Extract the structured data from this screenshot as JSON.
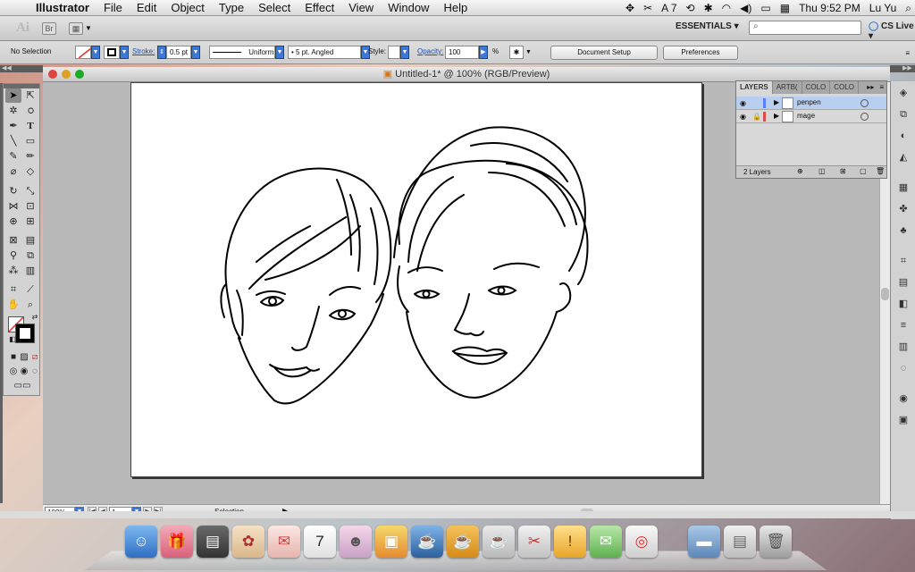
{
  "menubar": {
    "apple_icon": "apple-icon",
    "app_name": "Illustrator",
    "items": [
      "File",
      "Edit",
      "Object",
      "Type",
      "Select",
      "Effect",
      "View",
      "Window",
      "Help"
    ],
    "status": {
      "adobe_num": "7",
      "clock": "Thu 9:52 PM",
      "user": "Lu Yu"
    }
  },
  "appbar": {
    "logo": "Ai",
    "bridge_label": "Br",
    "workspace": "ESSENTIALS ▾",
    "search_placeholder": "",
    "cs_live": "CS Live ▾"
  },
  "control": {
    "selection": "No Selection",
    "stroke_label": "Stroke:",
    "stroke_value": "0.5 pt",
    "profile": "Uniform",
    "brush": "5 pt. Angled",
    "style_label": "Style:",
    "opacity_label": "Opacity:",
    "opacity_value": "100",
    "percent": "%",
    "doc_setup": "Document Setup",
    "preferences": "Preferences"
  },
  "document": {
    "title": "Untitled-1* @ 100% (RGB/Preview)"
  },
  "status": {
    "zoom": "100%",
    "page": "1",
    "tool": "Selection"
  },
  "layers": {
    "tabs": [
      "LAYERS",
      "ARTB(",
      "COLO",
      "COLO"
    ],
    "rows": [
      {
        "name": "penpen",
        "color": "#5b7dff"
      },
      {
        "name": "mage",
        "color": "#e04a4a"
      }
    ],
    "count": "2 Layers"
  },
  "colors": {
    "accent": "#3b78d8",
    "selected_row": "#b8cff0"
  }
}
